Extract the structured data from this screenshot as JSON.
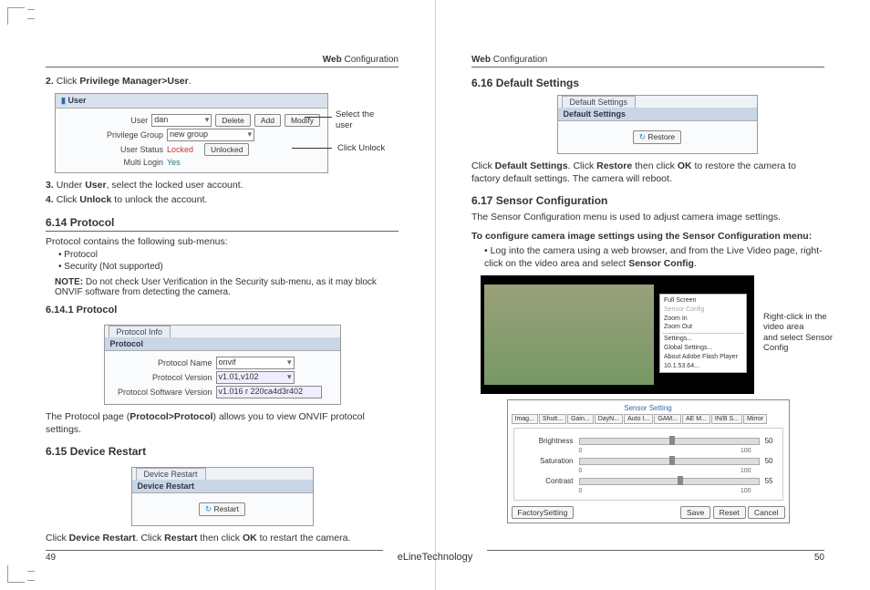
{
  "header": {
    "web": "Web",
    "label": "Configuration"
  },
  "left": {
    "step2": {
      "n": "2.",
      "pre": "Click ",
      "bold": "Privilege Manager>User",
      "post": "."
    },
    "user_panel": {
      "title": "User",
      "rows": {
        "user": {
          "label": "User",
          "value": "dan",
          "btns": [
            "Delete",
            "Add",
            "Modify"
          ]
        },
        "group": {
          "label": "Privilege Group",
          "value": "new group"
        },
        "status": {
          "label": "User Status",
          "value": "Locked",
          "btn": "Unlocked"
        },
        "multi": {
          "label": "Multi Login",
          "value": "Yes"
        }
      }
    },
    "callout_select": "Select the\nuser",
    "callout_unlock": "Click Unlock",
    "step3": {
      "n": "3.",
      "pre": "Under ",
      "bold": "User",
      "post": ", select the locked user account."
    },
    "step4": {
      "n": "4.",
      "pre": "Click ",
      "bold": "Unlock",
      "post": " to unlock the account."
    },
    "s614": {
      "title": "6.14  Protocol",
      "intro": "Protocol contains the following sub-menus:",
      "b1": "Protocol",
      "b2": "Security (Not supported)"
    },
    "note": {
      "pre": "NOTE:",
      "body": " Do not check User Verification in the Security sub-menu, as it may block ONVIF software from detecting the camera."
    },
    "s6141": {
      "title": "6.14.1 Protocol"
    },
    "proto_panel": {
      "tab": "Protocol Info",
      "rows": [
        {
          "label": "Protocol Name",
          "val": "onvif"
        },
        {
          "label": "Protocol Version",
          "val": "v1.01,v102"
        },
        {
          "label": "Protocol Software Version",
          "val": "v1.016 r 220ca4d3r402"
        }
      ]
    },
    "proto_text": {
      "pre": "The Protocol page (",
      "bold": "Protocol>Protocol",
      "post": ") allows you to view ONVIF protocol settings."
    },
    "s615": {
      "title": "6.15  Device Restart"
    },
    "device_panel": {
      "tab": "Device Restart",
      "head": "Device Restart",
      "btn": "Restart",
      "icon": "↻"
    },
    "device_text": {
      "t1": "Click ",
      "b1": "Device Restart",
      "t2": ". Click ",
      "b2": "Restart",
      "t3": " then click ",
      "b3": "OK",
      "t4": " to restart the camera."
    },
    "page_num": "49"
  },
  "right": {
    "s616": {
      "title": "6.16  Default Settings"
    },
    "default_panel": {
      "tab": "Default Settings",
      "head": "Default Settings",
      "btn": "Restore",
      "icon": "↻"
    },
    "default_text": {
      "t1": "Click ",
      "b1": "Default Settings",
      "t2": ". Click ",
      "b2": "Restore",
      "t3": " then click ",
      "b3": "OK",
      "t4": " to restore the camera to factory default settings. The camera will reboot."
    },
    "s617": {
      "title": "6.17  Sensor Configuration",
      "intro": "The Sensor Configuration menu is used to adjust camera image settings.",
      "lead": "To configure camera image settings using the Sensor Configuration menu:",
      "bullet": "Log into the camera using a web browser, and from the Live Video page, right-click on the video area and select ",
      "bold": "Sensor Config",
      "post": "."
    },
    "ctx_menu": [
      "Full Screen",
      "Sensor Config",
      "Zoom In",
      "Zoom Out",
      "",
      "Settings...",
      "Global Settings...",
      "About Adobe Flash Player 10.1.53.64..."
    ],
    "callout_video": "Right-click in the video area\nand select Sensor Config",
    "sensor_dialog": {
      "title": "Sensor Setting",
      "tabs": [
        "Imag...",
        "Shutt...",
        "Gain...",
        "DayN...",
        "Auto I...",
        "GAM...",
        "AE M...",
        "IN/B S...",
        "Mirror"
      ],
      "sliders": [
        {
          "label": "Brightness",
          "val": 50,
          "pos": 50
        },
        {
          "label": "Saturation",
          "val": 50,
          "pos": 50
        },
        {
          "label": "Contrast",
          "val": 55,
          "pos": 55
        }
      ],
      "scale": {
        "min": "0",
        "max": "100"
      },
      "btns": {
        "factory": "FactorySetting",
        "save": "Save",
        "reset": "Reset",
        "cancel": "Cancel"
      }
    },
    "page_num": "50"
  },
  "brand": "eLineTechnology"
}
